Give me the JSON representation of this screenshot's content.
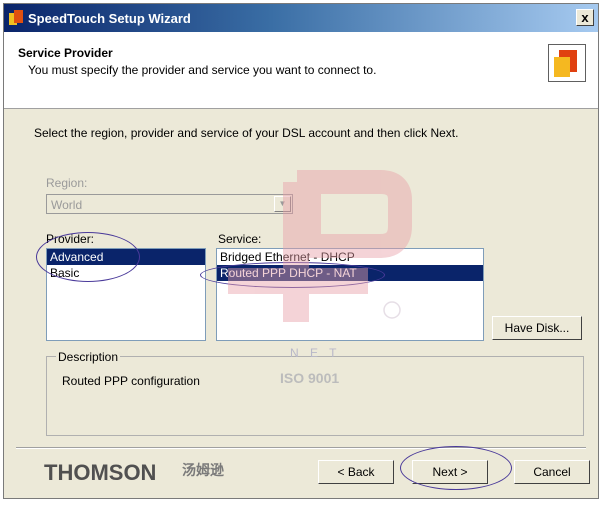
{
  "window": {
    "title": "SpeedTouch Setup Wizard",
    "close_label": "x"
  },
  "header": {
    "title": "Service Provider",
    "subtitle": "You must specify the provider and service you want to connect to."
  },
  "instructions": "Select the region, provider and service of your DSL account and then click Next.",
  "region": {
    "label": "Region:",
    "value": "World"
  },
  "provider": {
    "label": "Provider:",
    "items": [
      "Advanced",
      "Basic"
    ],
    "selected": "Advanced"
  },
  "service": {
    "label": "Service:",
    "items": [
      "Bridged Ethernet - DHCP",
      "Routed PPP DHCP - NAT"
    ],
    "selected": "Routed PPP DHCP - NAT"
  },
  "buttons": {
    "have_disk": "Have Disk...",
    "back": "< Back",
    "next": "Next >",
    "cancel": "Cancel"
  },
  "description": {
    "label": "Description",
    "text": "Routed PPP configuration"
  },
  "brand": {
    "name": "THOMSON",
    "sub": "汤姆逊"
  },
  "watermark": {
    "text1": "N E T",
    "text2": "ISO 9001"
  },
  "colors": {
    "selection": "#0a246a",
    "annotation": "#4a3a9a",
    "watermark": "#e8a0a8"
  }
}
